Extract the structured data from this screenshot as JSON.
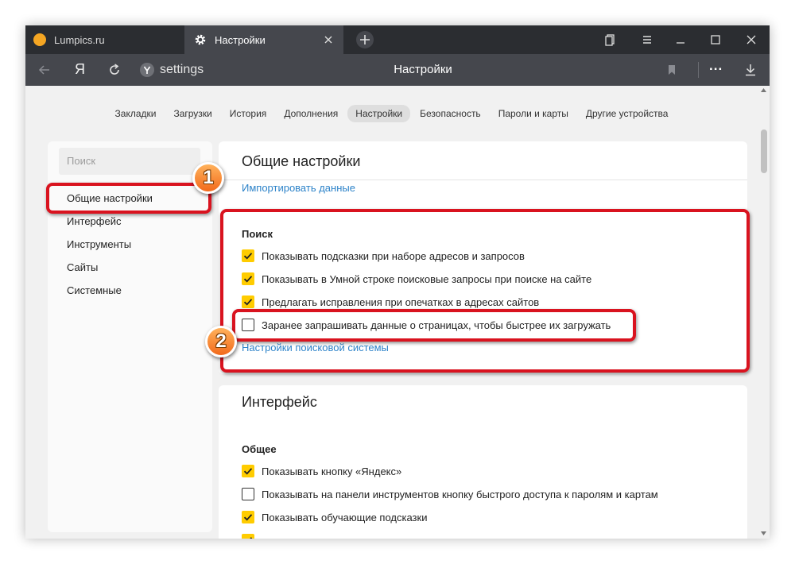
{
  "tabs": [
    {
      "label": "Lumpics.ru"
    },
    {
      "label": "Настройки"
    }
  ],
  "toolbar": {
    "yandex_label": "Я",
    "address": "settings",
    "page_title": "Настройки",
    "more_label": "..."
  },
  "nav": {
    "items": [
      "Закладки",
      "Загрузки",
      "История",
      "Дополнения",
      "Настройки",
      "Безопасность",
      "Пароли и карты",
      "Другие устройства"
    ],
    "active": "Настройки"
  },
  "sidebar": {
    "search_placeholder": "Поиск",
    "items": [
      "Общие настройки",
      "Интерфейс",
      "Инструменты",
      "Сайты",
      "Системные"
    ]
  },
  "general": {
    "title": "Общие настройки",
    "import_link": "Импортировать данные",
    "search_section": "Поиск",
    "options": [
      {
        "label": "Показывать подсказки при наборе адресов и запросов",
        "checked": true
      },
      {
        "label": "Показывать в Умной строке поисковые запросы при поиске на сайте",
        "checked": true
      },
      {
        "label": "Предлагать исправления при опечатках в адресах сайтов",
        "checked": true
      },
      {
        "label": "Заранее запрашивать данные о страницах, чтобы быстрее их загружать",
        "checked": false
      }
    ],
    "search_engine_link": "Настройки поисковой системы"
  },
  "interface": {
    "title": "Интерфейс",
    "section": "Общее",
    "options": [
      {
        "label": "Показывать кнопку «Яндекс»",
        "checked": true
      },
      {
        "label": "Показывать на панели инструментов кнопку быстрого доступа к паролям и картам",
        "checked": false
      },
      {
        "label": "Показывать обучающие подсказки",
        "checked": true
      },
      {
        "label": "",
        "checked": true
      }
    ]
  },
  "annotations": {
    "badge1": "1",
    "badge2": "2",
    "color": "#d9131f"
  },
  "colors": {
    "checkbox_on": "#ffcc00",
    "link": "#2d83c9",
    "titlebar": "#2b2d31",
    "toolbar": "#45474d"
  }
}
